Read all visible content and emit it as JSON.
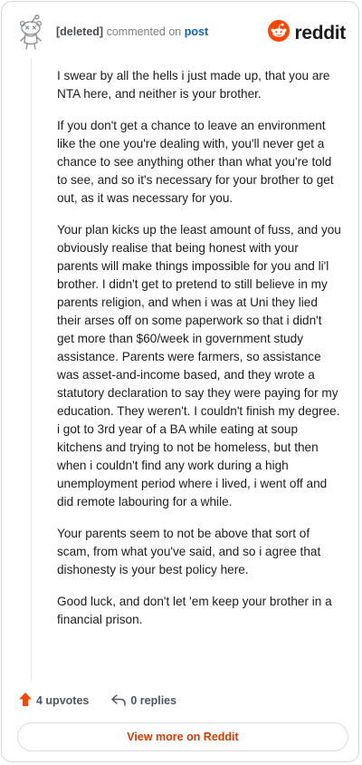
{
  "comment": {
    "author": "[deleted]",
    "action": "commented on",
    "target": "post",
    "paragraphs": [
      "I swear by all the hells i just made up, that you are NTA here, and neither is your brother.",
      "If you don't get a chance to leave an environment like the one you're dealing with, you'll never get a chance to see anything other than what you're told to see, and so it's necessary for your brother to get out, as it was necessary for you.",
      "Your plan kicks up the least amount of fuss, and you obviously realise that being honest with your parents will make things impossible for you and li'l brother. I didn't get to pretend to still believe in my parents religion, and when i was at Uni they lied their arses off on some paperwork so that i didn't get more than $60/week in government study assistance. Parents were farmers, so assistance was asset-and-income based, and they wrote a statutory declaration to say they were paying for my education. They weren't. I couldn't finish my degree. i got to 3rd year of a BA while eating at soup kitchens and trying to not be homeless, but then when i couldn't find any work during a high unemployment period where i lived, i went off and did remote labouring for a while.",
      "Your parents seem to not be above that sort of scam, from what you've said, and so i agree that dishonesty is your best policy here.",
      "Good luck, and don't let 'em keep your brother in a financial prison."
    ]
  },
  "brand": {
    "name": "reddit",
    "accent": "#ff4500"
  },
  "footer": {
    "upvotes": "4 upvotes",
    "replies": "0 replies",
    "view_more": "View more on Reddit"
  },
  "icons": {
    "avatar": "deleted-user-snoo-icon",
    "logo": "reddit-logo-icon",
    "upvote": "upvote-arrow-icon",
    "reply": "reply-arrow-icon"
  }
}
